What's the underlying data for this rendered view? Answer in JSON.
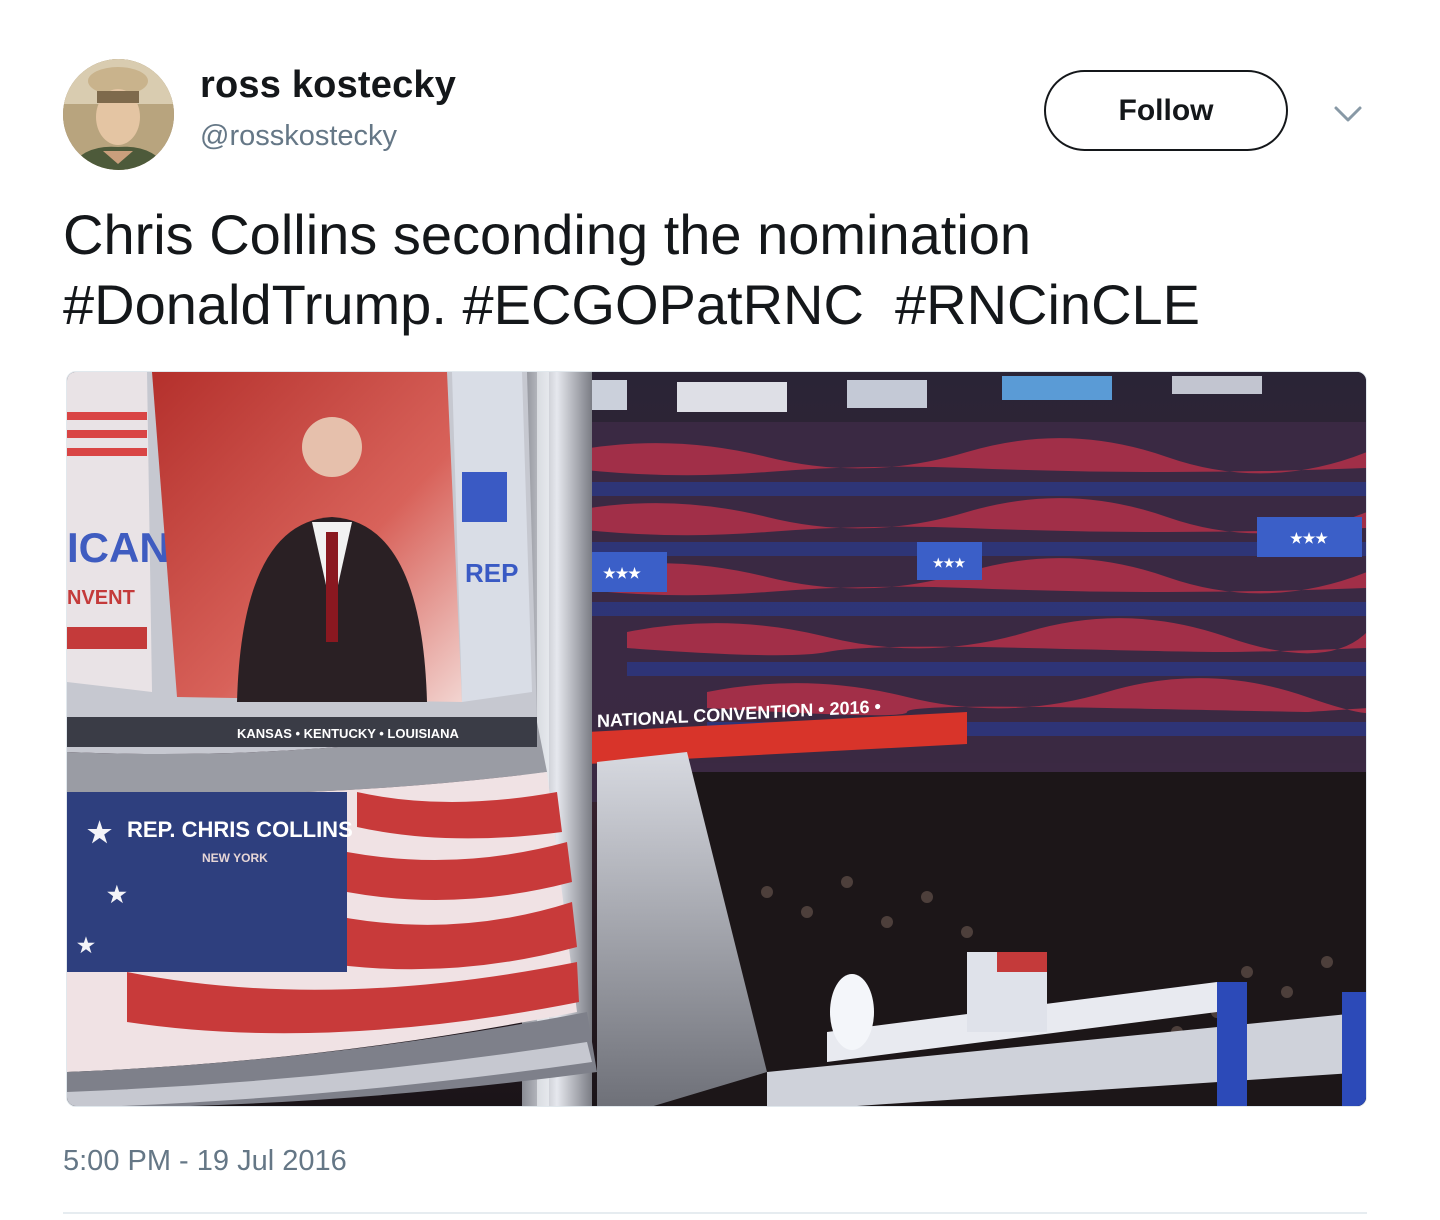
{
  "author": {
    "display_name": "ross kostecky",
    "handle": "@rosskostecky",
    "avatar_icon": "profile-photo"
  },
  "actions": {
    "follow_label": "Follow",
    "more_icon": "chevron-down-icon"
  },
  "tweet": {
    "text_line1": "Chris Collins seconding the nomination",
    "hashtag1": "#DonaldTrump.",
    "hashtag2": "#ECGOPatRNC",
    "hashtag3": "#RNCinCLE",
    "timestamp": "5:00 PM - 19 Jul 2016"
  },
  "media": {
    "screen_banner": "REP. CHRIS COLLINS",
    "screen_subbanner": "NEW YORK",
    "ticker_text": "KANSAS • KENTUCKY • LOUISIANA",
    "arena_banner": "NATIONAL CONVENTION • 2016 •",
    "screen_side_text": "ICAN",
    "screen_side_text2": "NVENT"
  },
  "colors": {
    "text": "#14171a",
    "secondary": "#657786",
    "divider": "#e6ecf0"
  }
}
